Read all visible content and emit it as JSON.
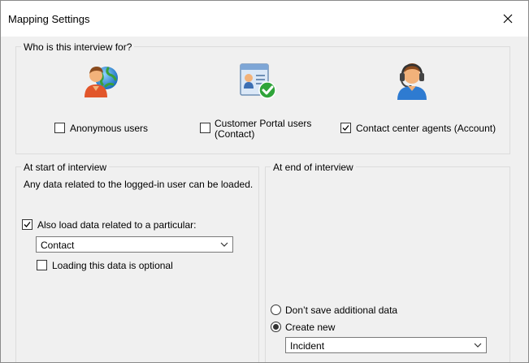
{
  "window": {
    "title": "Mapping Settings"
  },
  "audience": {
    "legend": "Who is this interview for?",
    "options": [
      {
        "label": "Anonymous users",
        "checked": false,
        "icon": "globe-user-icon"
      },
      {
        "label_line1": "Customer Portal users",
        "label_line2": "(Contact)",
        "checked": false,
        "icon": "portal-user-card-icon"
      },
      {
        "label": "Contact center agents (Account)",
        "checked": true,
        "icon": "headset-agent-icon"
      }
    ]
  },
  "start": {
    "legend": "At start of interview",
    "description": "Any data related to the logged-in user can be loaded.",
    "also_load_label": "Also load data related to a particular:",
    "also_load_checked": true,
    "entity_select_value": "Contact",
    "optional_label": "Loading this data is optional",
    "optional_checked": false
  },
  "end": {
    "legend": "At end of interview",
    "radio_dont_save": "Don’t save additional data",
    "radio_create_new": "Create new",
    "selected": "create_new",
    "create_select_value": "Incident"
  },
  "colors": {
    "dialog_bg": "#f0f0f0",
    "title_bg": "#ffffff",
    "border": "#dcdcdc"
  }
}
